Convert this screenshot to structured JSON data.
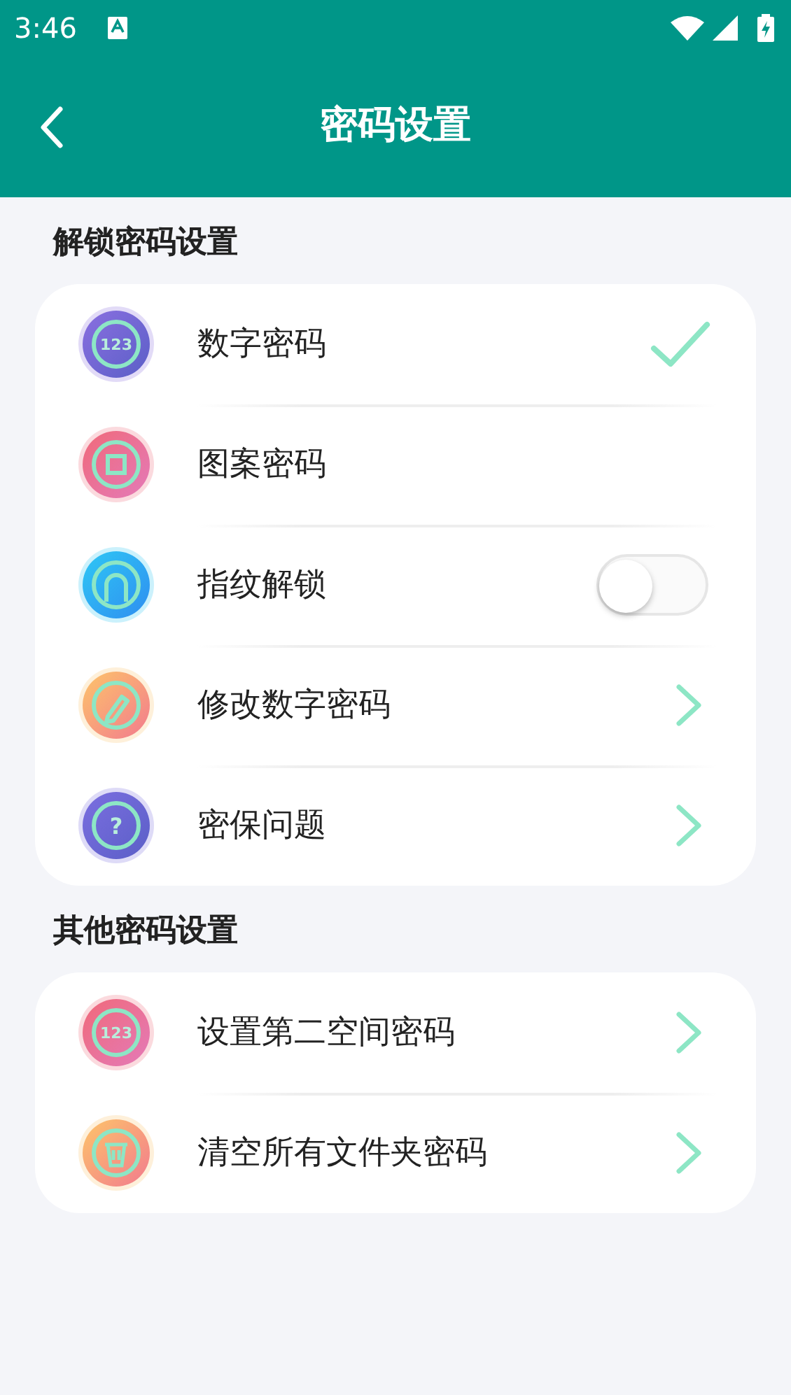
{
  "status_bar": {
    "time": "3:46"
  },
  "header": {
    "title": "密码设置"
  },
  "sections": [
    {
      "title": "解锁密码设置",
      "items": [
        {
          "label": "数字密码",
          "icon_text": "123",
          "kind": "check",
          "selected": true
        },
        {
          "label": "图案密码",
          "kind": "check",
          "selected": false
        },
        {
          "label": "指纹解锁",
          "kind": "toggle",
          "on": false
        },
        {
          "label": "修改数字密码",
          "kind": "arrow"
        },
        {
          "label": "密保问题",
          "icon_text": "?",
          "kind": "arrow"
        }
      ]
    },
    {
      "title": "其他密码设置",
      "items": [
        {
          "label": "设置第二空间密码",
          "icon_text": "123",
          "kind": "arrow"
        },
        {
          "label": "清空所有文件夹密码",
          "kind": "arrow"
        }
      ]
    }
  ]
}
